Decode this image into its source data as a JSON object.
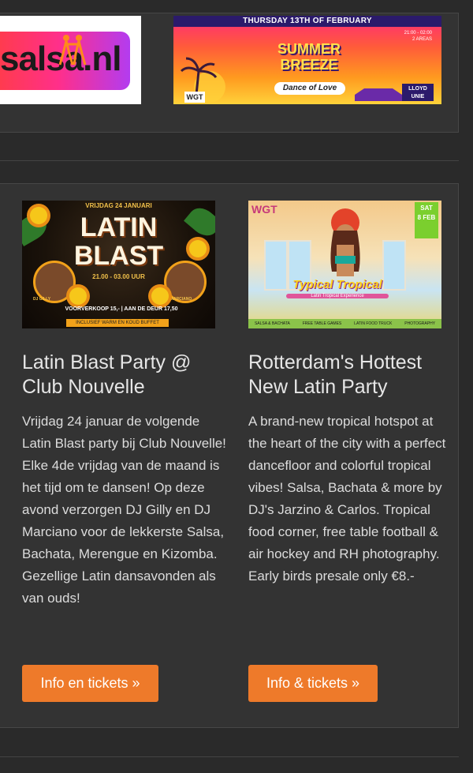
{
  "banners": {
    "salsa": {
      "text": "salsa.nl"
    },
    "summer": {
      "topline": "THURSDAY 13TH OF FEBRUARY",
      "logo_line1": "SUMMER",
      "logo_line2": "BREEZE",
      "tagline": "Dance of Love",
      "info_line1": "21:00 - 02:00",
      "info_line2": "2 AREAS",
      "badge": "WGT",
      "venue_line1": "LLOYD",
      "venue_line2": "UNIE"
    }
  },
  "events": [
    {
      "image": {
        "top": "VRIJDAG 24 JANUARI",
        "title_line1": "LATIN",
        "title_line2": "BLAST",
        "time": "21.00 - 03.00 UUR",
        "dj_left": "DJ GILLY",
        "dj_right": "DJ MARCIANO",
        "bottom": "VOORVERKOOP 15,- | AAN DE DEUR 17,50",
        "foot": "INCLUSIEF WARM EN KOUD BUFFET"
      },
      "title": "Latin Blast Party @ Club Nouvelle",
      "description": "Vrijdag 24 januar de volgende Latin Blast party bij Club Nouvelle! Elke 4de vrijdag van de maand is het tijd om te dansen! Op deze avond verzorgen DJ Gilly en DJ Marciano voor de lekkerste Salsa, Bachata, Merengue en Kizomba. Gezellige Latin dansavonden als van ouds!",
      "button": "Info en tickets »"
    },
    {
      "image": {
        "logo": "WGT",
        "date_line1": "SAT",
        "date_line2": "8 FEB",
        "title": "Typical Tropical",
        "subtitle": "Latin Tropical Experience",
        "footer": [
          "SALSA & BACHATA",
          "FREE TABLE GAMES",
          "LATIN FOOD TRUCK",
          "PHOTOGRAPHY"
        ]
      },
      "title": "Rotterdam's Hottest New Latin Party",
      "description": "A brand-new tropical hotspot at the heart of the city with a perfect dancefloor and colorful tropical vibes! Salsa, Bachata & more by DJ's Jarzino & Carlos. Tropical food corner, free table football & air hockey and RH photography. Early birds presale only €8.-",
      "button": "Info & tickets »"
    }
  ],
  "colors": {
    "page_bg": "#2a2a2a",
    "panel_bg": "#333333",
    "button_bg": "#ee7a2a",
    "text": "#e6e6e6"
  }
}
